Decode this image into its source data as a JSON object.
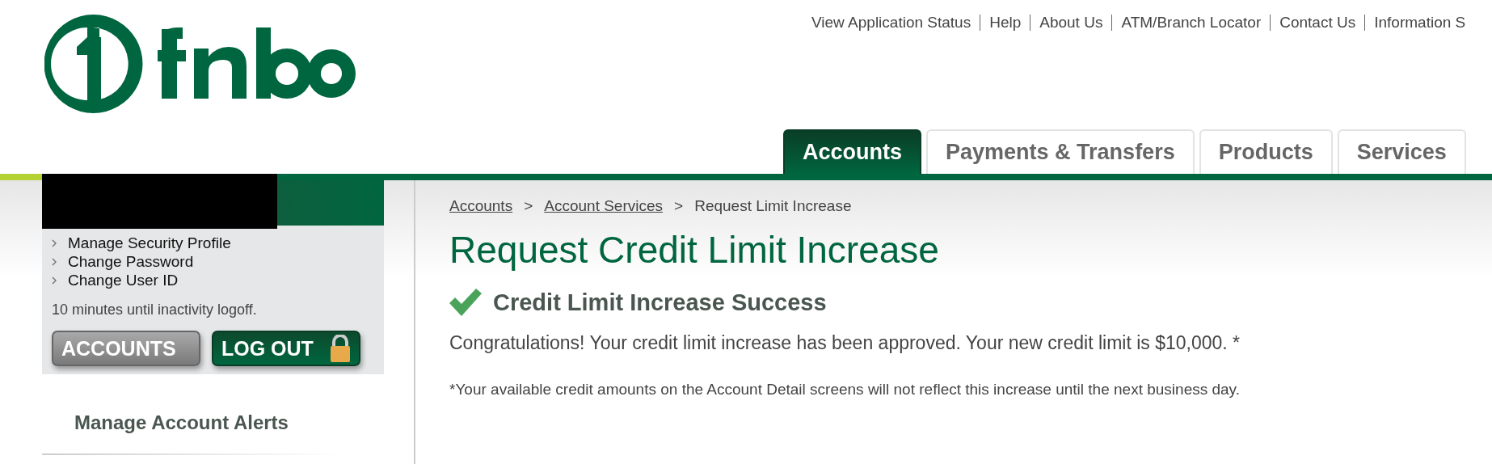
{
  "top_links": [
    "View Application Status",
    "Help",
    "About Us",
    "ATM/Branch Locator",
    "Contact Us",
    "Information S"
  ],
  "tabs": [
    {
      "label": "Accounts",
      "selected": true
    },
    {
      "label": "Payments & Transfers",
      "selected": false
    },
    {
      "label": "Products",
      "selected": false
    },
    {
      "label": "Services",
      "selected": false
    }
  ],
  "sidebar": {
    "menu": [
      "Manage Security Profile",
      "Change Password",
      "Change User ID"
    ],
    "logoff_notice": "10 minutes until inactivity logoff.",
    "buttons": [
      {
        "label": "ACCOUNTS",
        "kind": "grey"
      },
      {
        "label": "LOG OUT",
        "kind": "logout"
      }
    ],
    "alerts_heading": "Manage Account Alerts"
  },
  "breadcrumb": [
    {
      "label": "Accounts",
      "kind": "link"
    },
    {
      "label": "Account Services",
      "kind": "link"
    },
    {
      "label": "Request Limit Increase",
      "kind": "current"
    }
  ],
  "separator": ">",
  "title": "Request Credit Limit Increase",
  "success_heading": "Credit Limit Increase Success",
  "message": "Congratulations! Your credit limit increase has been approved. Your new credit limit is $10,000. *",
  "footnote": "*Your available credit amounts on the Account Detail screens will not reflect this increase until the next business day."
}
